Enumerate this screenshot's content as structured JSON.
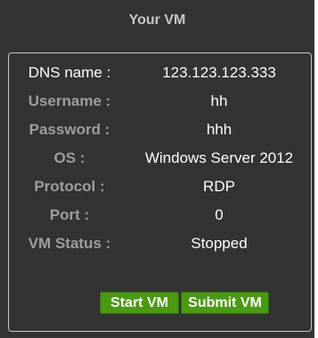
{
  "header": {
    "title": "Your VM"
  },
  "vm": {
    "dns_label": "DNS name :",
    "dns_value": "123.123.123.333",
    "username_label": "Username :",
    "username_value": "hh",
    "password_label": "Password :",
    "password_value": "hhh",
    "os_label": "OS :",
    "os_value": "Windows Server 2012",
    "protocol_label": "Protocol :",
    "protocol_value": "RDP",
    "port_label": "Port :",
    "port_value": "0",
    "status_label": "VM Status :",
    "status_value": "Stopped"
  },
  "actions": {
    "start_label": "Start VM",
    "submit_label": "Submit VM"
  },
  "colors": {
    "panel_background": "#333333",
    "button_green": "#4a9a12"
  }
}
